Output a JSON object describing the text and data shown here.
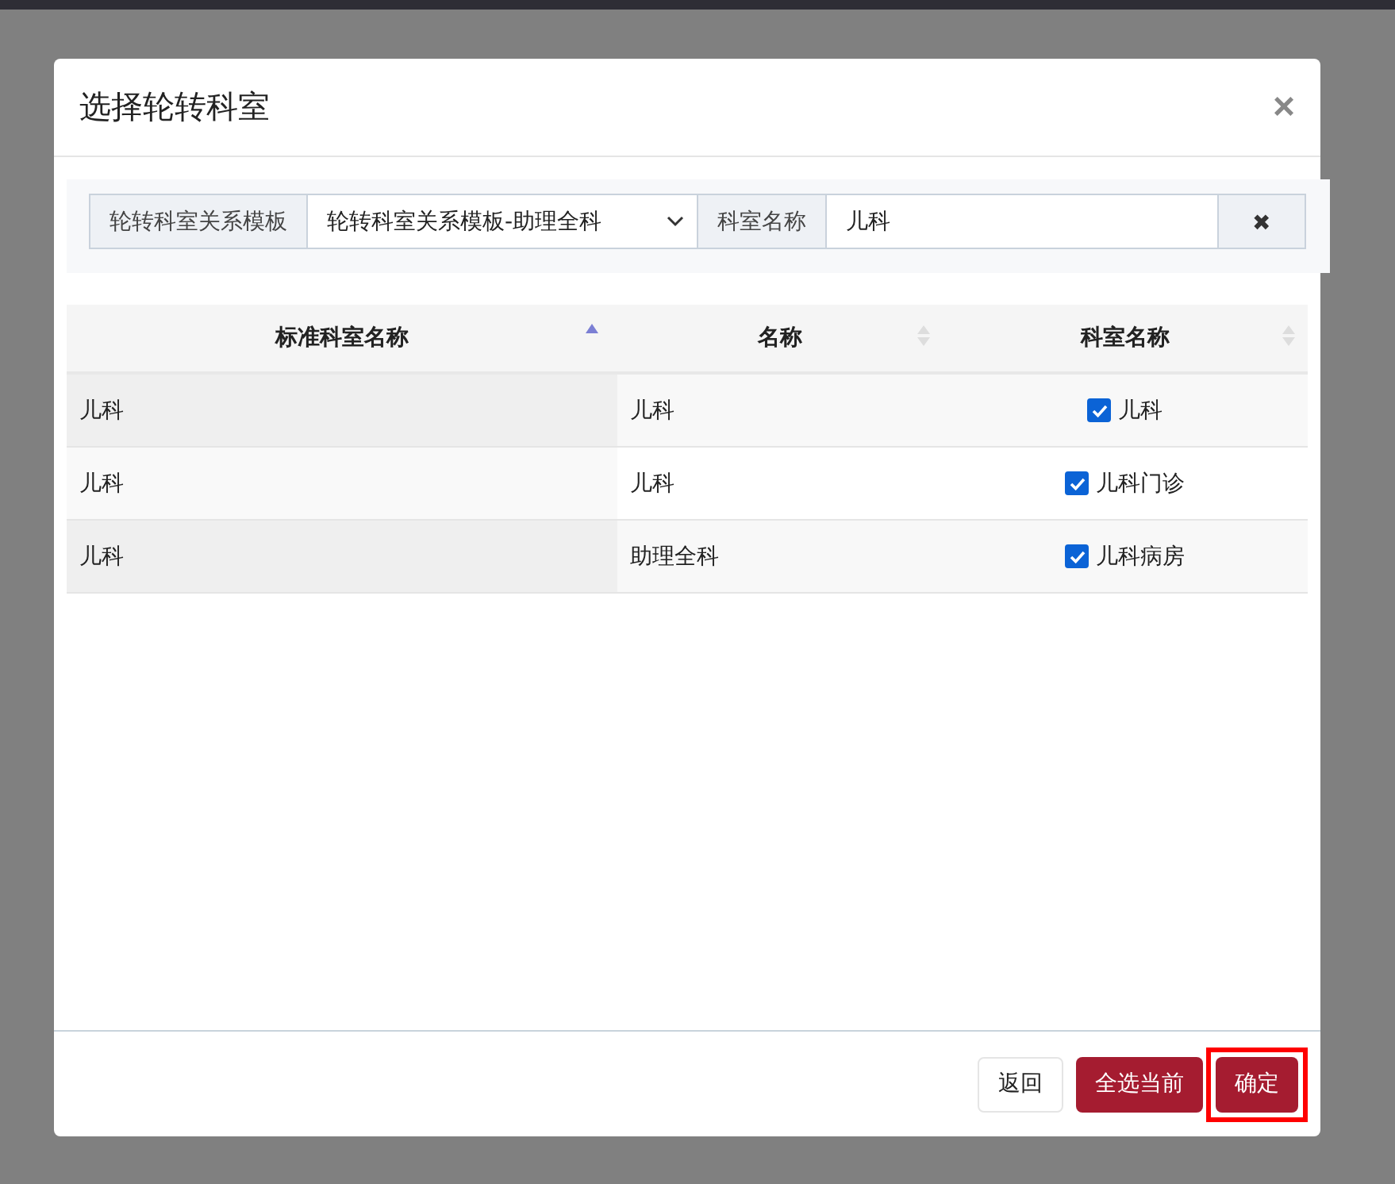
{
  "dialog": {
    "title": "选择轮转科室",
    "close": "×"
  },
  "filter": {
    "template_label": "轮转科室关系模板",
    "template_value": "轮转科室关系模板-助理全科",
    "name_label": "科室名称",
    "name_value": "儿科",
    "clear": "✖"
  },
  "table": {
    "columns": [
      {
        "label": "标准科室名称",
        "sorted": true
      },
      {
        "label": "名称",
        "sorted": false
      },
      {
        "label": "科室名称",
        "sorted": false
      }
    ],
    "rows": [
      {
        "standard": "儿科",
        "name": "儿科",
        "department": "儿科",
        "checked": true
      },
      {
        "standard": "儿科",
        "name": "儿科",
        "department": "儿科门诊",
        "checked": true
      },
      {
        "standard": "儿科",
        "name": "助理全科",
        "department": "儿科病房",
        "checked": true
      }
    ]
  },
  "footer": {
    "back": "返回",
    "select_all": "全选当前",
    "confirm": "确定",
    "confirm_highlighted": true
  }
}
